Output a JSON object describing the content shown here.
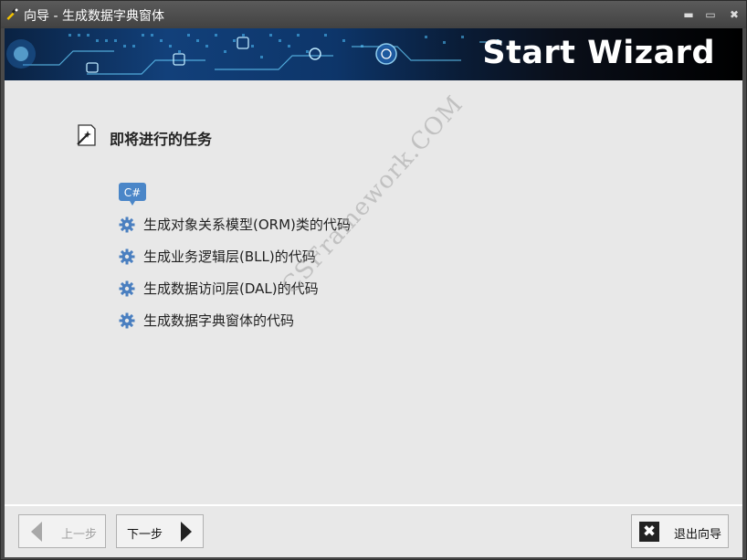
{
  "window": {
    "title": "向导 - 生成数据字典窗体",
    "minimize_symbol": "▬",
    "maximize_symbol": "▭",
    "close_symbol": "✖"
  },
  "banner": {
    "title": "Start Wizard"
  },
  "task_section": {
    "header": "即将进行的任务",
    "header_icon": "wizard-wand-icon",
    "language_badge": "C#",
    "items": [
      {
        "label": "生成对象关系模型(ORM)类的代码",
        "icon": "gear-icon"
      },
      {
        "label": "生成业务逻辑层(BLL)的代码",
        "icon": "gear-icon"
      },
      {
        "label": "生成数据访问层(DAL)的代码",
        "icon": "gear-icon"
      },
      {
        "label": "生成数据字典窗体的代码",
        "icon": "gear-icon"
      }
    ]
  },
  "watermark": "CSFramework.COM",
  "footer": {
    "prev_label": "上一步",
    "next_label": "下一步",
    "exit_label": "退出向导",
    "exit_symbol": "✖"
  },
  "colors": {
    "accent_blue": "#4a7fc0",
    "content_bg": "#e8e8e8",
    "titlebar_bg": "#4a4a4a"
  }
}
